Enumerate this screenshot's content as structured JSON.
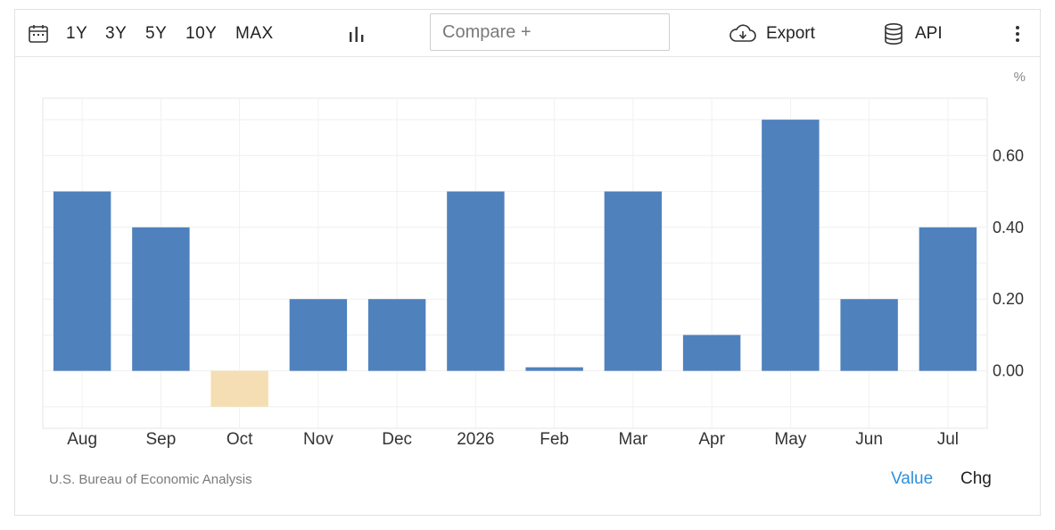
{
  "toolbar": {
    "ranges": [
      "1Y",
      "3Y",
      "5Y",
      "10Y",
      "MAX"
    ],
    "compare_placeholder": "Compare +",
    "export_label": "Export",
    "api_label": "API"
  },
  "chart_data": {
    "type": "bar",
    "categories": [
      "Aug",
      "Sep",
      "Oct",
      "Nov",
      "Dec",
      "2026",
      "Feb",
      "Mar",
      "Apr",
      "May",
      "Jun",
      "Jul"
    ],
    "values": [
      0.5,
      0.4,
      -0.1,
      0.2,
      0.2,
      0.5,
      0.01,
      0.5,
      0.1,
      0.7,
      0.2,
      0.4
    ],
    "yunit": "%",
    "yticks": [
      "0.00",
      "0.20",
      "0.40",
      "0.60"
    ],
    "ylim": [
      -0.16,
      0.76
    ],
    "grid": true,
    "colors": {
      "positive": "#4f81bd",
      "negative": "#f5deb3"
    }
  },
  "footer": {
    "source": "U.S. Bureau of Economic Analysis",
    "value_label": "Value",
    "chg_label": "Chg"
  }
}
